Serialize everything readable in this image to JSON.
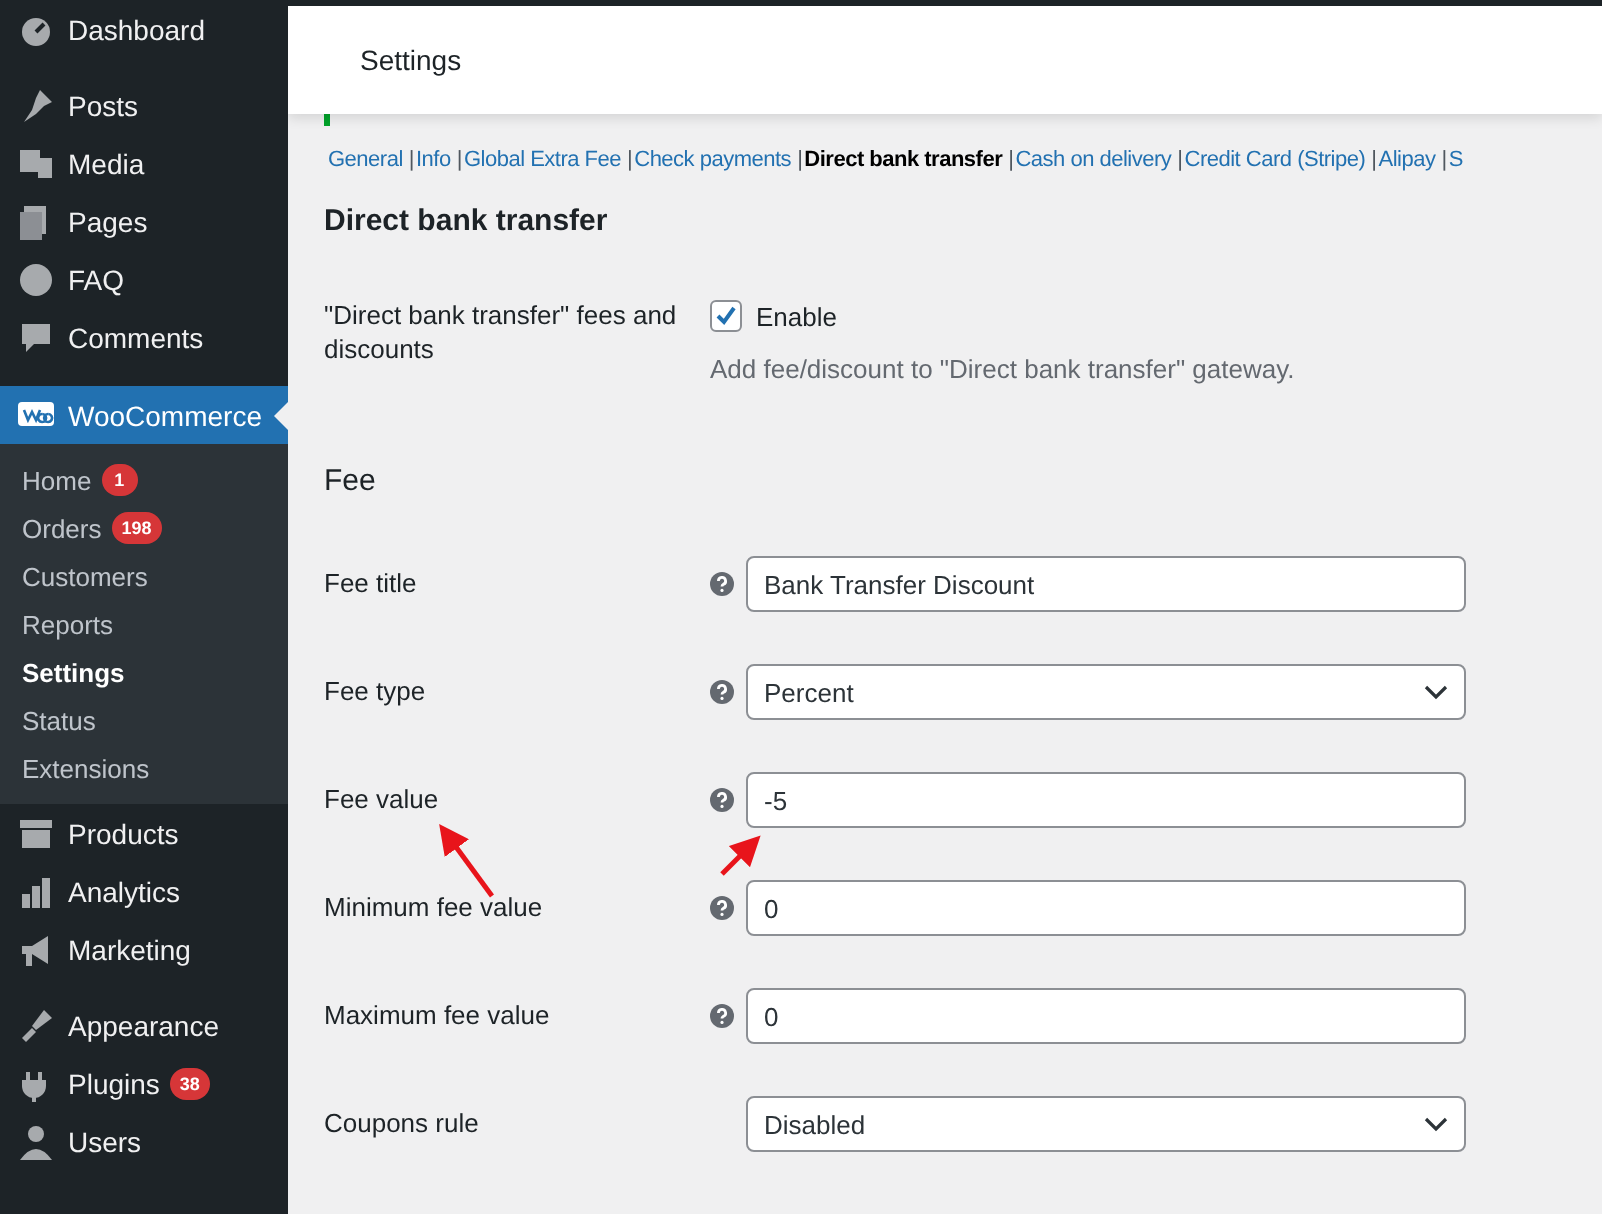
{
  "sidebar": {
    "items": [
      {
        "kind": "main",
        "label": "Dashboard",
        "selected": false
      },
      {
        "kind": "main",
        "label": "Posts",
        "selected": false
      },
      {
        "kind": "main",
        "label": "Media",
        "selected": false
      },
      {
        "kind": "main",
        "label": "Pages",
        "selected": false
      },
      {
        "kind": "main",
        "label": "FAQ",
        "selected": false
      },
      {
        "kind": "main",
        "label": "Comments",
        "selected": false
      },
      {
        "kind": "main",
        "label": "WooCommerce",
        "selected": true,
        "children": [
          {
            "label": "Home",
            "badge": "1",
            "selected": false
          },
          {
            "label": "Orders",
            "badge": "198",
            "selected": false
          },
          {
            "label": "Customers",
            "selected": false
          },
          {
            "label": "Reports",
            "selected": false
          },
          {
            "label": "Settings",
            "selected": true
          },
          {
            "label": "Status",
            "selected": false
          },
          {
            "label": "Extensions",
            "selected": false
          }
        ]
      },
      {
        "kind": "main",
        "label": "Products",
        "selected": false
      },
      {
        "kind": "main",
        "label": "Analytics",
        "selected": false
      },
      {
        "kind": "main",
        "label": "Marketing",
        "selected": false
      },
      {
        "kind": "main",
        "label": "Appearance",
        "selected": false
      },
      {
        "kind": "main",
        "label": "Plugins",
        "badge": "38",
        "selected": false
      },
      {
        "kind": "main",
        "label": "Users",
        "selected": false
      }
    ]
  },
  "header": {
    "title": "Settings"
  },
  "tabs": [
    {
      "label": "General",
      "separator": "|",
      "selected": false
    },
    {
      "label": "Info",
      "separator": "|",
      "selected": false
    },
    {
      "label": "Global Extra Fee",
      "separator": "|",
      "selected": false
    },
    {
      "label": "Check payments",
      "separator": "|",
      "selected": false
    },
    {
      "label": "Direct bank transfer",
      "separator": "|",
      "selected": true
    },
    {
      "label": "Cash on delivery",
      "separator": "|",
      "selected": false
    },
    {
      "label": "Credit Card (Stripe)",
      "separator": "|",
      "selected": false
    },
    {
      "label": "Alipay",
      "separator": "|",
      "selected": false
    },
    {
      "label": "S",
      "selected": false
    }
  ],
  "section_title": "Direct bank transfer",
  "enable_row": {
    "label": "\"Direct bank transfer\" fees and discounts",
    "checkbox_label": "Enable",
    "checked": true,
    "description": "Add fee/discount to \"Direct bank transfer\" gateway."
  },
  "fee_section": {
    "title": "Fee",
    "fields": [
      {
        "kind": "text",
        "label": "Fee title",
        "help": true,
        "value": "Bank Transfer Discount"
      },
      {
        "kind": "select",
        "label": "Fee type",
        "help": true,
        "value": "Percent"
      },
      {
        "kind": "text",
        "label": "Fee value",
        "help": true,
        "value": "-5"
      },
      {
        "kind": "text",
        "label": "Minimum fee value",
        "help": true,
        "value": "0"
      },
      {
        "kind": "text",
        "label": "Maximum fee value",
        "help": true,
        "value": "0"
      },
      {
        "kind": "select",
        "label": "Coupons rule",
        "help": false,
        "value": "Disabled"
      }
    ]
  }
}
